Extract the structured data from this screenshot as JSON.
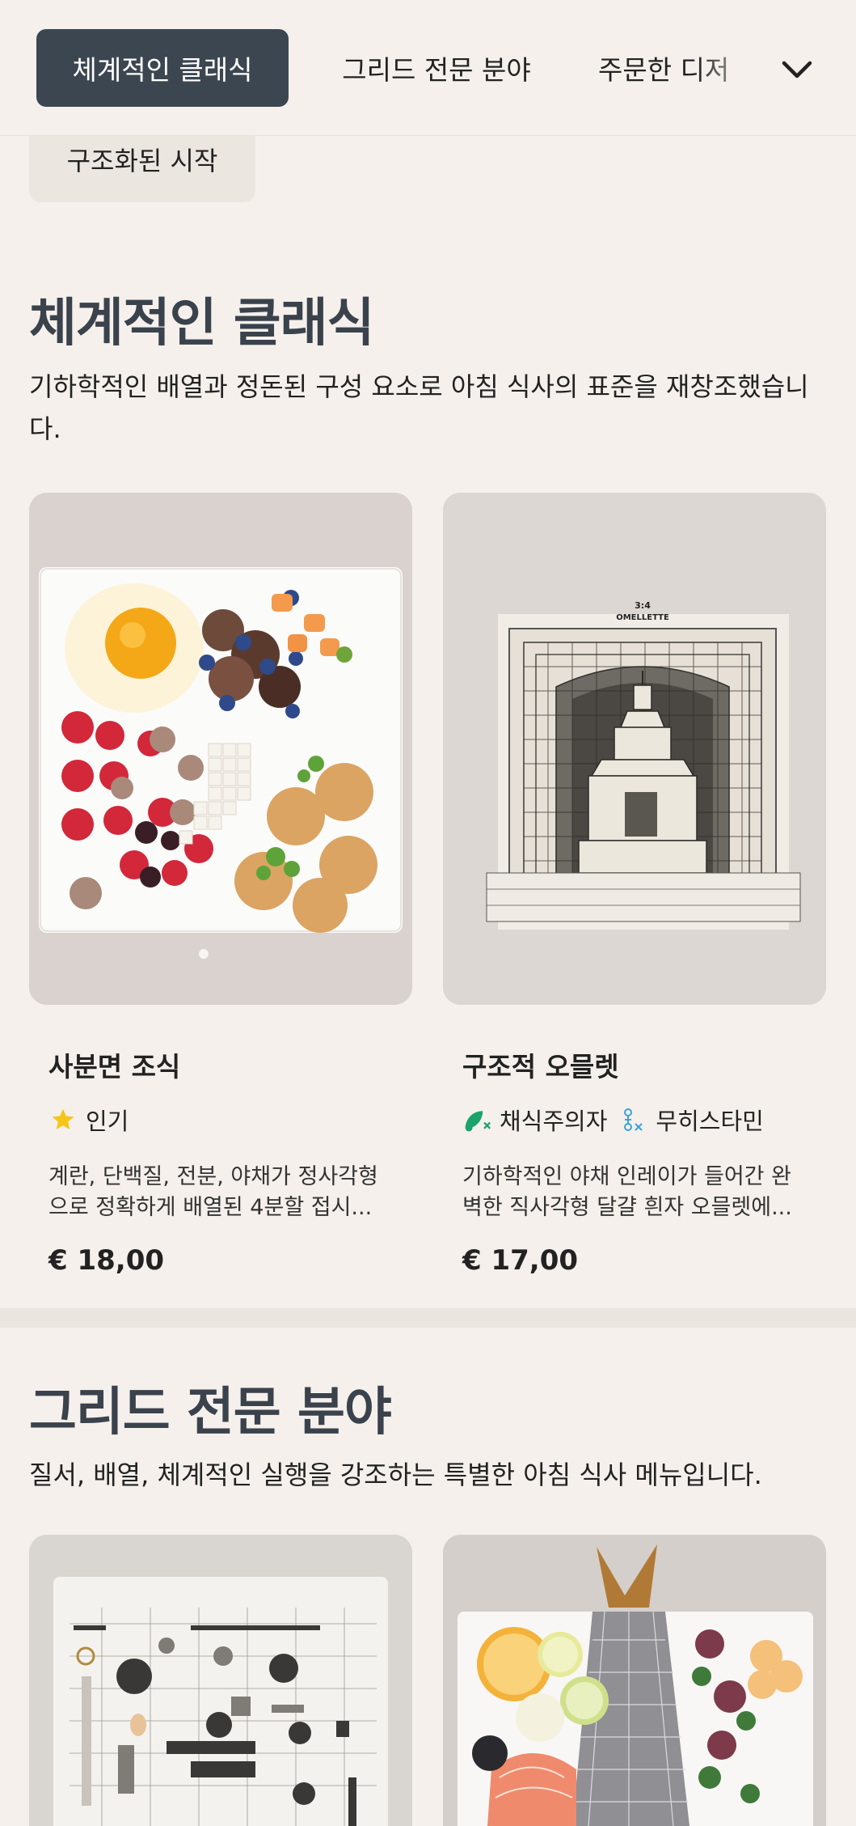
{
  "nav": {
    "tabs": [
      {
        "label": "체계적인 클래식",
        "active": true
      },
      {
        "label": "그리드 전문 분야",
        "active": false
      },
      {
        "label": "주문한 디저",
        "active": false
      }
    ],
    "chevron_icon": "chevron-down-icon"
  },
  "sub_chip": {
    "label": "구조화된 시작"
  },
  "sections": [
    {
      "title": "체계적인 클래식",
      "description": "기하학적인 배열과 정돈된 구성 요소로 아침 식사의 표준을 재창조했습니다.",
      "items": [
        {
          "name": "사분면 조식",
          "tags": [
            {
              "icon": "star-icon",
              "label": "인기",
              "color": "#f5c518"
            }
          ],
          "description": "계란, 단백질, 전분, 야채가 정사각형으로 정확하게 배열된 4분할 접시...",
          "price": "€ 18,00"
        },
        {
          "name": "구조적 오믈렛",
          "tags": [
            {
              "icon": "vegetarian-icon",
              "label": "채식주의자",
              "color": "#1aa36a"
            },
            {
              "icon": "no-histamine-icon",
              "label": "무히스타민",
              "color": "#3aa3d8"
            }
          ],
          "description": "기하학적인 야채 인레이가 들어간 완벽한 직사각형 달걀 흰자 오믈렛에...",
          "price": "€ 17,00",
          "image_text": [
            "3:4",
            "OMELLETTE"
          ]
        }
      ]
    },
    {
      "title": "그리드 전문 분야",
      "description": "질서, 배열, 체계적인 실행을 강조하는 특별한 아침 식사 메뉴입니다."
    }
  ],
  "colors": {
    "background": "#f5f0ec",
    "active_tab": "#3c4651",
    "heading": "#3a424c",
    "star": "#f5c518",
    "vegetarian": "#1aa36a",
    "histamine": "#3aa3d8"
  }
}
